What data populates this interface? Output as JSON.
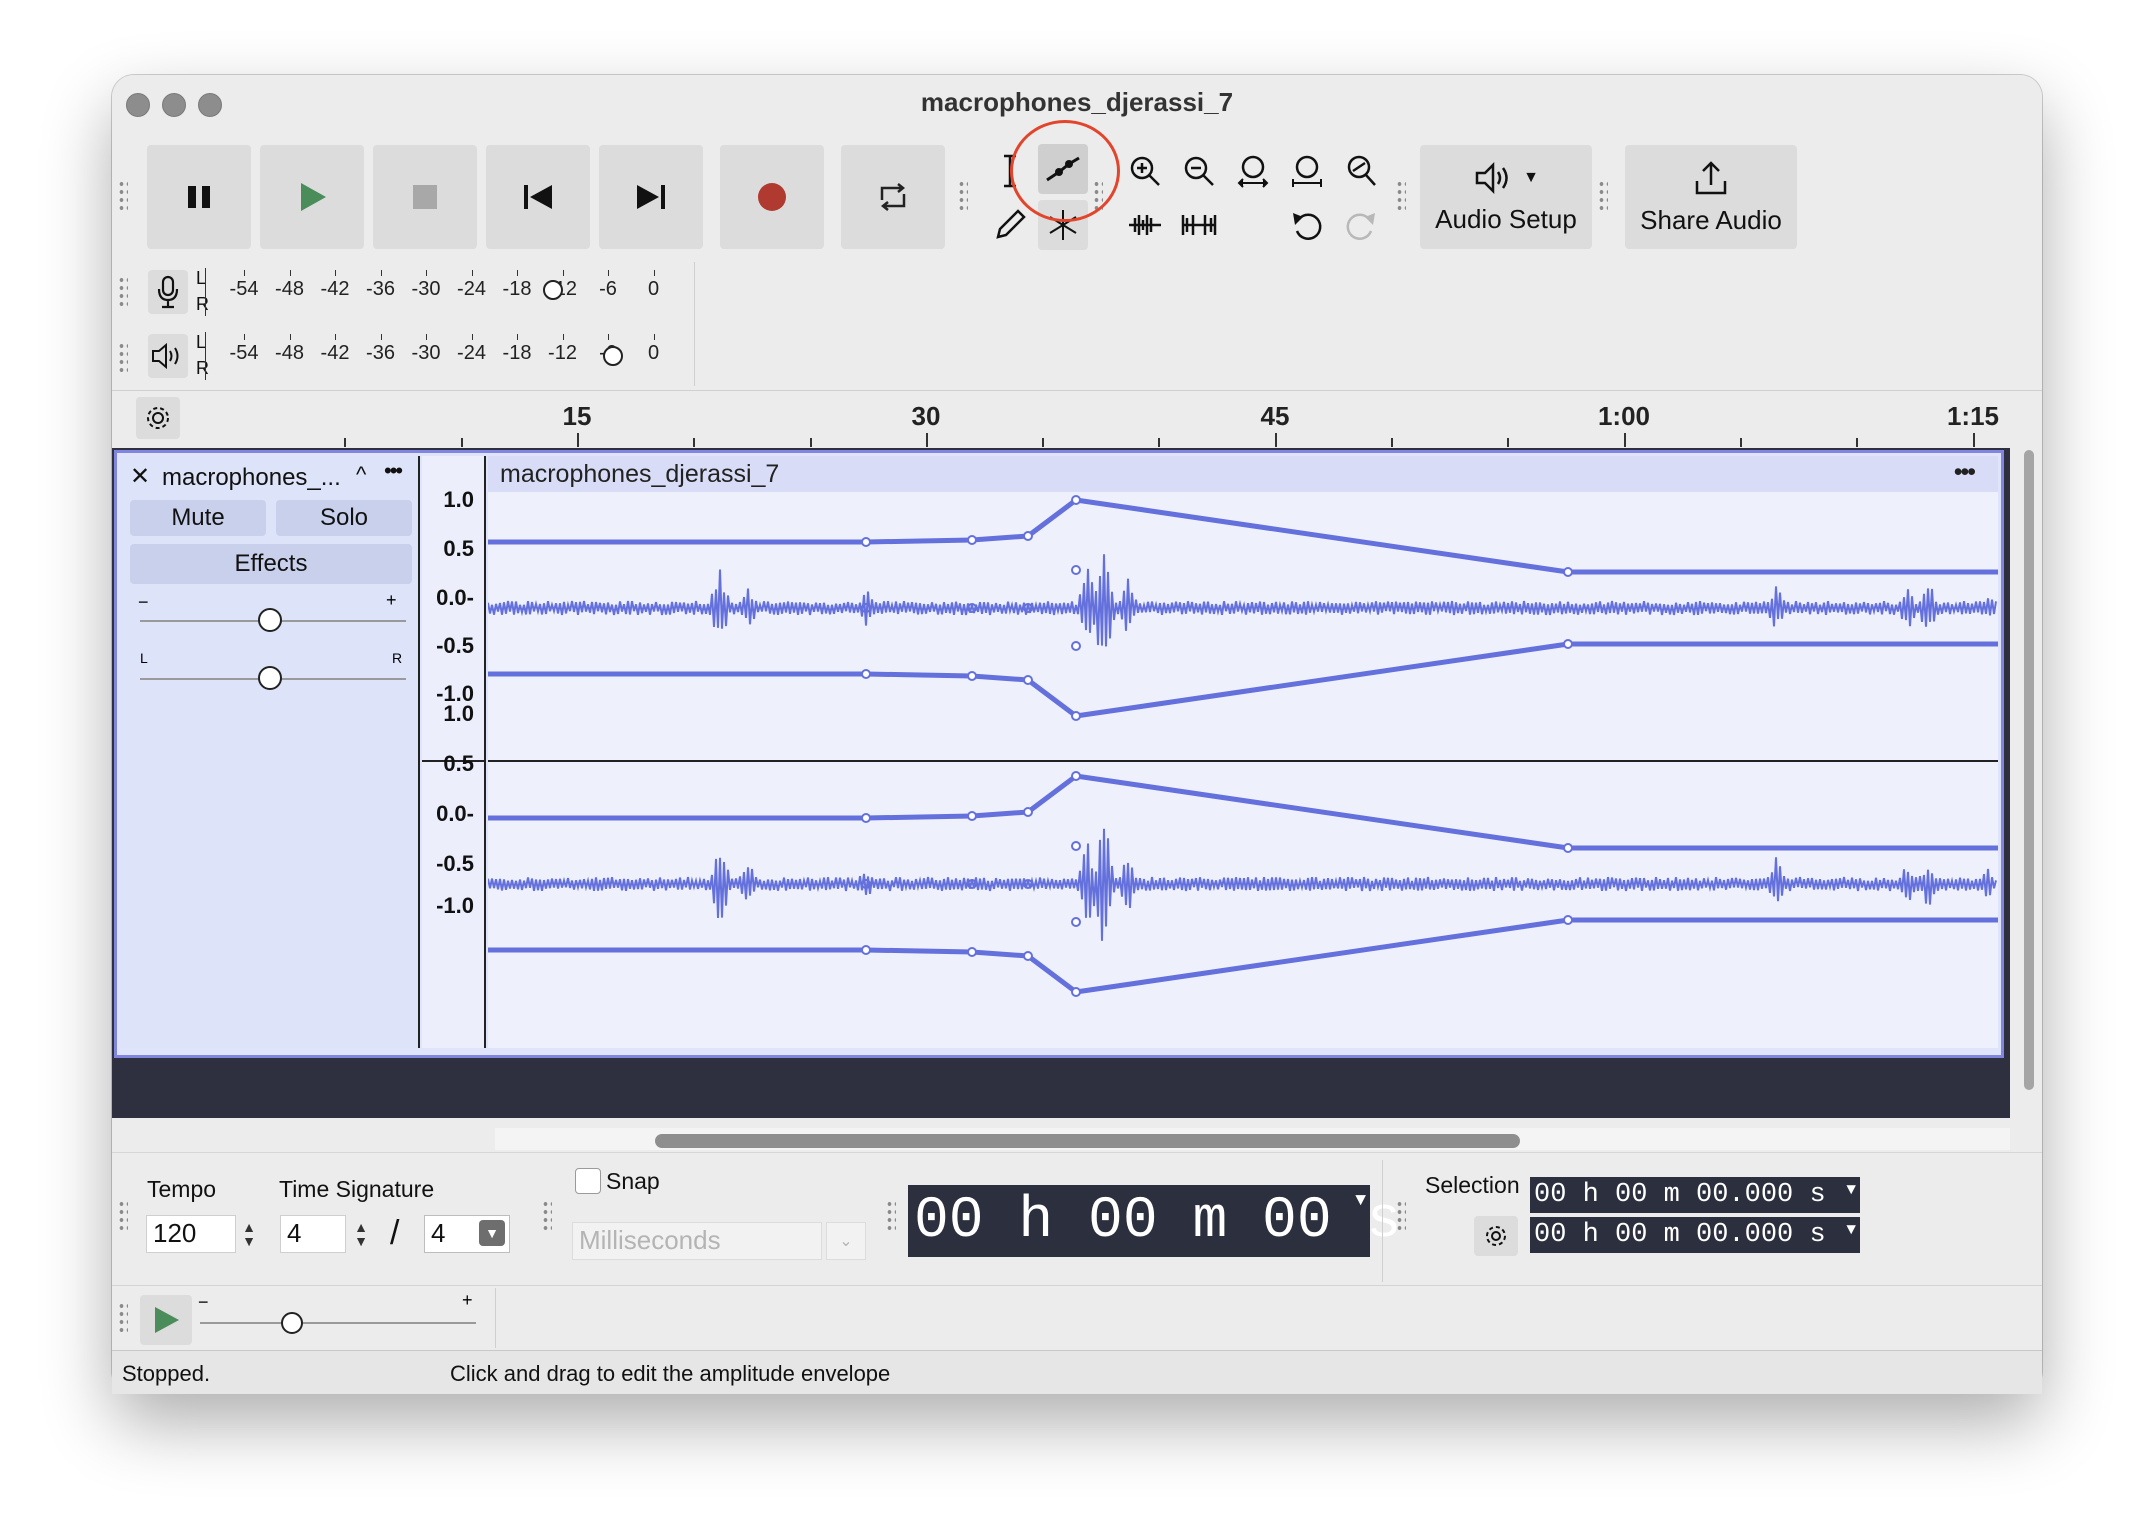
{
  "window": {
    "title": "macrophones_djerassi_7"
  },
  "audio_setup": {
    "label": "Audio Setup"
  },
  "share_audio": {
    "label": "Share Audio"
  },
  "meters": {
    "record_scale": [
      "-54",
      "-48",
      "-42",
      "-36",
      "-30",
      "-24",
      "-18",
      "-12",
      "-6",
      "0"
    ],
    "play_scale": [
      "-54",
      "-48",
      "-42",
      "-36",
      "-30",
      "-24",
      "-18",
      "-12",
      "-6",
      "0"
    ],
    "L": "L",
    "R": "R"
  },
  "ruler": {
    "ticks": [
      "15",
      "30",
      "45",
      "1:00",
      "1:15"
    ]
  },
  "track": {
    "name": "macrophones_...",
    "mute": "Mute",
    "solo": "Solo",
    "effects": "Effects",
    "gain_minus": "−",
    "gain_plus": "+",
    "pan_left": "L",
    "pan_right": "R",
    "clip_name": "macrophones_djerassi_7",
    "clip_menu": "•••",
    "menu": "•••",
    "scale": [
      "1.0",
      "0.5",
      "0.0-",
      "-0.5",
      "-1.0"
    ]
  },
  "bottom": {
    "tempo_label": "Tempo",
    "tempo_value": "120",
    "time_sig_label": "Time Signature",
    "time_sig_num": "4",
    "time_sig_slash": "/",
    "time_sig_den": "4",
    "snap_label": "Snap",
    "snap_unit": "Milliseconds",
    "big_time": "00 h 00 m 00 s",
    "selection_label": "Selection",
    "sel_start": "00 h 00 m 00.000 s",
    "sel_end": "00 h 00 m 00.000 s",
    "speed_minus": "−",
    "speed_plus": "+"
  },
  "status": {
    "state": "Stopped.",
    "hint": "Click and drag to edit the amplitude envelope"
  },
  "colors": {
    "waveform": "#6470dc",
    "track_bg": "#2e3040",
    "record": "#b03a30",
    "play": "#4a8c5a",
    "annotation": "#e2452b"
  }
}
